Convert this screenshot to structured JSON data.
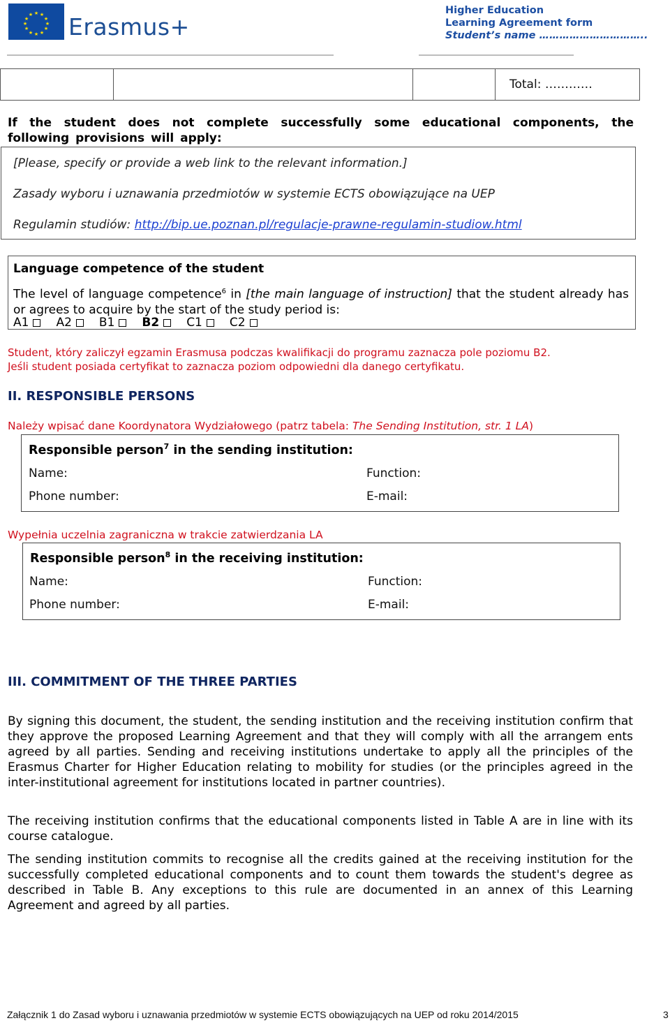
{
  "header": {
    "logo_text": "Erasmus+",
    "title_line1": "Higher Education",
    "title_line2": "Learning Agreement form",
    "title_line3": "Student’s name ………………………….."
  },
  "total_table": {
    "total_label": "Total: …………"
  },
  "provisions": {
    "heading": "If the student does not complete successfully some educational components, the following provisions will apply:",
    "instruction": "[Please, specify or provide a web link to the relevant information.]",
    "rules_text": "Zasady wyboru i uznawania przedmiotów w systemie ECTS obowiązujące na UEP",
    "regulations_label": "Regulamin studiów: ",
    "regulations_link": "http://bip.ue.poznan.pl/regulacje-prawne-regulamin-studiow.html"
  },
  "language": {
    "title": "Language competence of the student",
    "body_part1": "The level of language competence",
    "footnote": "6",
    "body_part2": " in ",
    "body_italic": "[the main language of instruction]",
    "body_part3": " that the student already has or agrees to acquire by the start of the study period is:",
    "levels": [
      {
        "label": "A1",
        "bold": false
      },
      {
        "label": "A2",
        "bold": false
      },
      {
        "label": "B1",
        "bold": false
      },
      {
        "label": "B2",
        "bold": true
      },
      {
        "label": "C1",
        "bold": false
      },
      {
        "label": "C2",
        "bold": false
      }
    ],
    "note_line1": "Student, który zaliczył egzamin Erasmusa podczas kwalifikacji do programu zaznacza pole poziomu B2.",
    "note_line2": "Jeśli student posiada certyfikat to zaznacza poziom odpowiedni dla danego certyfikatu."
  },
  "section2": {
    "heading": "II.  RESPONSIBLE PERSONS",
    "sending_note_prefix": "Należy wpisać dane Koordynatora Wydziałowego (patrz tabela: ",
    "sending_note_italic": "The Sending Institution, str. 1 LA",
    "sending_note_suffix": ")",
    "sending": {
      "title_prefix": "Responsible person",
      "footnote": "7",
      "title_suffix": " in the sending institution:",
      "name_label": "Name:",
      "function_label": "Function:",
      "phone_label": "Phone number:",
      "email_label": "E-mail:"
    },
    "receiving_note": "Wypełnia uczelnia zagraniczna w trakcie zatwierdzania LA",
    "receiving": {
      "title_prefix": "Responsible person",
      "footnote": "8",
      "title_suffix": " in the receiving institution:",
      "name_label": "Name:",
      "function_label": "Function:",
      "phone_label": "Phone number:",
      "email_label": "E-mail:"
    }
  },
  "section3": {
    "heading": "III. COMMITMENT OF THE THREE PARTIES",
    "paragraphs": [
      "By signing this document, the student, the sending institution and the receiving institution confirm that they approve the proposed Learning Agreement and that they will comply with all the arrangem ents agreed by all parties. Sending and receiving institutions undertake to apply all the principles of the Erasmus Charter for Higher Education relating to mobility for studies (or the principles agreed in the inter-institutional agreement for institutions located in partner countries).",
      "The receiving institution confirms that the educational components listed in Table A are in line with its course catalogue.",
      "The sending institution commits to recognise all the credits gained at the receiving institution for the successfully completed educational components and to count them towards the student's degree as described in Table B. Any exceptions to this rule are documented in an annex of this Learning Agreement and agreed by all parties."
    ]
  },
  "footer": {
    "text": "Załącznik 1 do Zasad wyboru i uznawania przedmiotów w systemie ECTS obowiązujących na UEP od roku 2014/2015",
    "page_number": "3"
  },
  "colors": {
    "brand_blue": "#1d4fa3",
    "heading_navy": "#0f2560",
    "note_red": "#d0101e",
    "link_blue": "#1b3fd1"
  }
}
